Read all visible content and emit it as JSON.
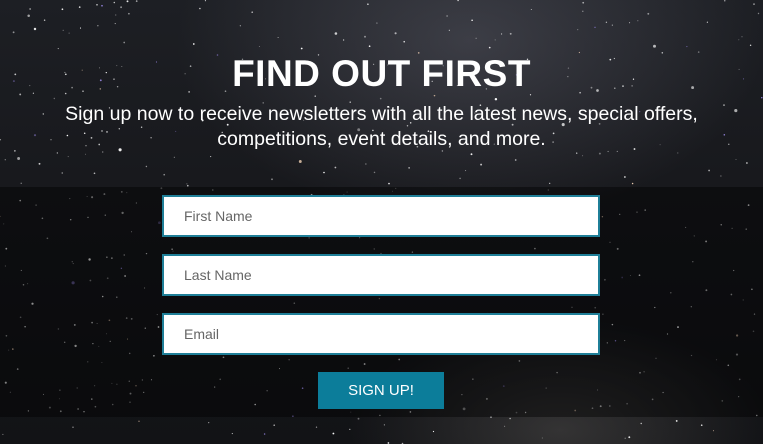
{
  "hero": {
    "title": "FIND OUT FIRST",
    "subtitle": "Sign up now to receive newsletters with all the latest news, special offers, competitions, event details, and more."
  },
  "form": {
    "first_name": {
      "placeholder": "First Name",
      "value": ""
    },
    "last_name": {
      "placeholder": "Last Name",
      "value": ""
    },
    "email": {
      "placeholder": "Email",
      "value": ""
    },
    "submit_label": "SIGN UP!"
  },
  "colors": {
    "accent": "#0c7d9a",
    "input_border": "#1f7f98",
    "background": "#141518",
    "text": "#ffffff"
  },
  "background": {
    "description_icon": "starfield-image"
  }
}
